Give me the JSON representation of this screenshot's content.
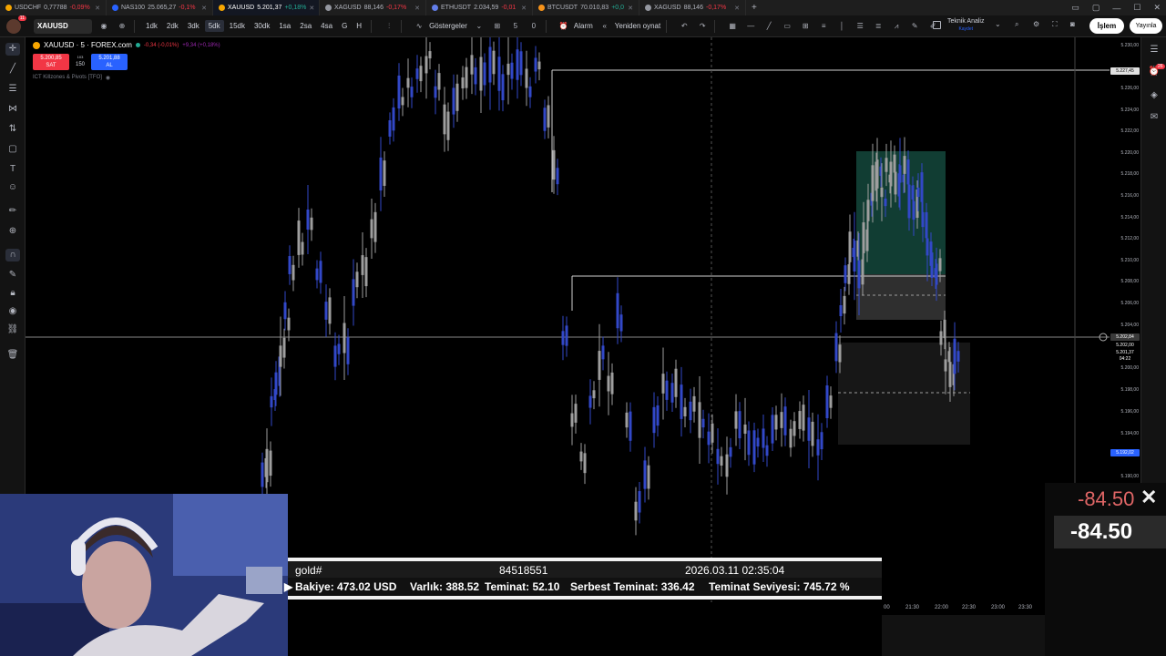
{
  "tabs": [
    {
      "symbol": "USDCHF",
      "value": "0,77788",
      "change": "-0,09%",
      "up": false,
      "dot": "#f7a600"
    },
    {
      "symbol": "NAS100",
      "value": "25.065,27",
      "change": "-0,1%",
      "up": false,
      "dot": "#2962ff"
    },
    {
      "symbol": "XAUUSD",
      "value": "5.201,37",
      "change": "+0,18%",
      "up": true,
      "dot": "#f7a600",
      "active": true
    },
    {
      "symbol": "XAGUSD",
      "value": "88,146",
      "change": "-0,17%",
      "up": false,
      "dot": "#9598a1"
    },
    {
      "symbol": "ETHUSDT",
      "value": "2.034,59",
      "change": "-0,01",
      "up": false,
      "dot": "#627eea"
    },
    {
      "symbol": "BTCUSDT",
      "value": "70.010,83",
      "change": "+0,0",
      "up": true,
      "dot": "#f7931a"
    },
    {
      "symbol": "XAGUSD",
      "value": "88,146",
      "change": "-0,17%",
      "up": false,
      "dot": "#9598a1"
    }
  ],
  "toolbar": {
    "avatar_badge": "11",
    "symbol": "XAUUSD",
    "timeframes": [
      "1dk",
      "2dk",
      "3dk",
      "5dk",
      "15dk",
      "30dk",
      "1sa",
      "2sa",
      "4sa",
      "G",
      "H"
    ],
    "active_timeframe": "5dk",
    "indicators_label": "Göstergeler",
    "indicator_count": "5",
    "indicator_count2": "0",
    "alarm_label": "Alarm",
    "replay_label": "Yeniden oynat",
    "ta_label": "Teknik Analiz",
    "ta_sub": "Kaydet",
    "trade_label": "İşlem",
    "publish_label": "Yayınla"
  },
  "legend": {
    "title": "XAUUSD · 5 · FOREX.com",
    "change": "-0,34 (-0,01%)",
    "change2": "+9,34 (+0,18%)",
    "sell_price": "5.200,85",
    "sell_label": "SAT",
    "buy_price": "5.201,88",
    "buy_label": "AL",
    "spread_top": "103",
    "spread": "150",
    "indicator": "ICT Killzones & Pivots [TFO]"
  },
  "right_badge": "26",
  "price_axis": {
    "labels": [
      "5.230,00",
      "5.226,00",
      "5.224,00",
      "5.222,00",
      "5.220,00",
      "5.218,00",
      "5.216,00",
      "5.214,00",
      "5.212,00",
      "5.210,00",
      "5.208,00",
      "5.206,00",
      "5.204,00",
      "5.200,00",
      "5.198,00",
      "5.196,00",
      "5.194,00",
      "5.190,00"
    ],
    "level_tag": "5.227,45",
    "crosshair_tag": "5.202,84",
    "current_price": "5.201,37",
    "current_time": "04:22",
    "small_tag": "5.202,00",
    "blue_tag": "5.192,02"
  },
  "terminal": {
    "symbol": "gold#",
    "ticket": "84518551",
    "time": "2026.03.11 02:35:04",
    "balance": "Bakiye: 473.02 USD",
    "equity": "Varlık: 388.52",
    "margin": "Teminat: 52.10",
    "free_margin": "Serbest Teminat: 336.42",
    "margin_level": "Teminat Seviyesi: 745.72 %"
  },
  "profit": {
    "value1": "-84.50",
    "value2": "-84.50"
  },
  "time_axis": [
    "00",
    "21:30",
    "22:00",
    "22:30",
    "23:00",
    "23:30"
  ],
  "colors": {
    "bull": "#3248c8",
    "bear": "#9e9e9e",
    "sell": "#f23645",
    "buy": "#2962ff",
    "zone_green": "#1f6f5c"
  }
}
